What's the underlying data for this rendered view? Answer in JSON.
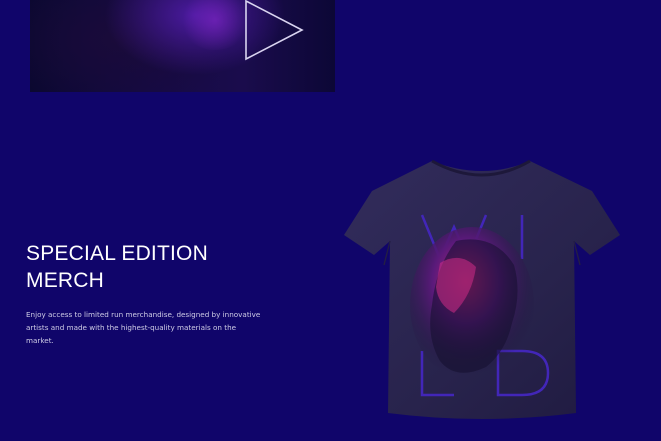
{
  "video": {
    "play_icon": "play-icon"
  },
  "merch": {
    "title_line1": "SPECIAL EDITION",
    "title_line2": "MERCH",
    "description": "Enjoy access to limited run merchandise, designed by innovative artists and made with the highest-quality materials on the market.",
    "tshirt_print_text": "WILD"
  },
  "colors": {
    "background": "#10056a",
    "shirt": "#2c2752",
    "print_accent": "#3b1aa8",
    "heading_text": "#ffffff"
  }
}
